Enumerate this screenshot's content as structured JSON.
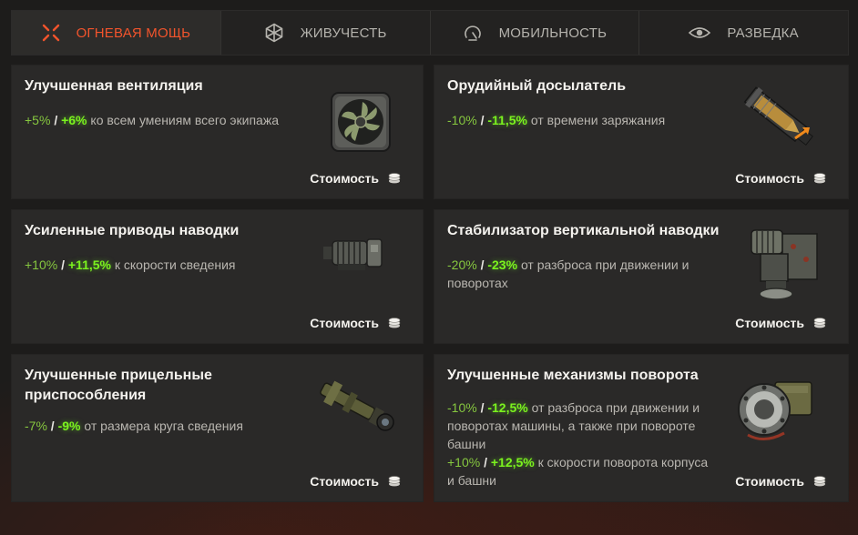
{
  "tabs": [
    {
      "label": "Огневая мощь",
      "icon": "crosshair-icon",
      "active": true
    },
    {
      "label": "Живучесть",
      "icon": "hexagon-shield-icon",
      "active": false
    },
    {
      "label": "Мобильность",
      "icon": "speedometer-icon",
      "active": false
    },
    {
      "label": "Разведка",
      "icon": "eye-icon",
      "active": false
    }
  ],
  "cost_label": "Стоимость",
  "colors": {
    "active_tab": "#f2542c",
    "bonus_base": "#86c73f",
    "bonus_improved": "#7bf21e",
    "card_bg": "#2a2928"
  },
  "cards": [
    {
      "title": "Улучшенная вентиляция",
      "icon": "ventilation-fan-image",
      "bonuses": [
        {
          "base": "+5%",
          "sep": "/",
          "improved": "+6%",
          "text": "ко всем умениям всего экипажа"
        }
      ]
    },
    {
      "title": "Орудийный досылатель",
      "icon": "gun-rammer-image",
      "bonuses": [
        {
          "base": "-10%",
          "sep": "/",
          "improved": "-11,5%",
          "text": "от времени заряжания"
        }
      ]
    },
    {
      "title": "Усиленные приводы наводки",
      "icon": "aiming-drive-motor-image",
      "bonuses": [
        {
          "base": "+10%",
          "sep": "/",
          "improved": "+11,5%",
          "text": "к скорости сведения"
        }
      ]
    },
    {
      "title": "Стабилизатор вертикальной наводки",
      "icon": "vertical-stabilizer-image",
      "bonuses": [
        {
          "base": "-20%",
          "sep": "/",
          "improved": "-23%",
          "text": "от разброса при движении и поворотах"
        }
      ]
    },
    {
      "title": "Улучшенные прицельные приспособления",
      "icon": "gun-sight-image",
      "bonuses": [
        {
          "base": "-7%",
          "sep": "/",
          "improved": "-9%",
          "text": "от размера круга сведения"
        }
      ]
    },
    {
      "title": "Улучшенные механизмы поворота",
      "icon": "turret-traverse-mechanism-image",
      "bonuses": [
        {
          "base": "-10%",
          "sep": "/",
          "improved": "-12,5%",
          "text": "от разброса при движении и поворотах машины, а также при повороте башни"
        },
        {
          "base": "+10%",
          "sep": "/",
          "improved": "+12,5%",
          "text": "к скорости поворота корпуса и башни"
        }
      ]
    }
  ]
}
